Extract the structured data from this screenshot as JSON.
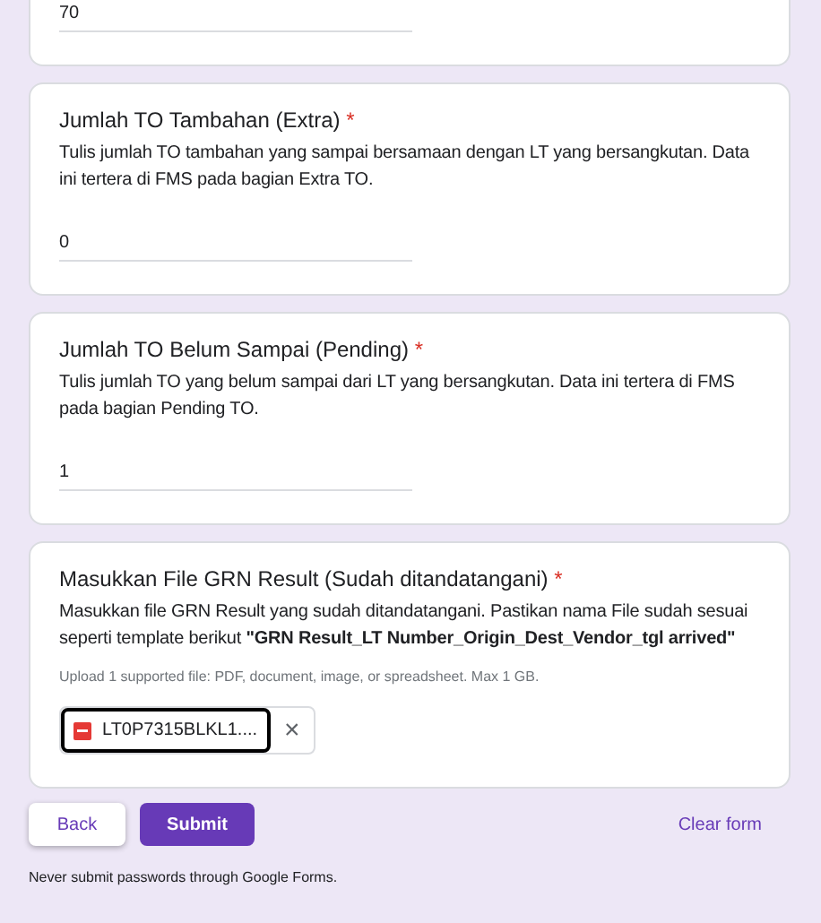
{
  "questions": [
    {
      "kind": "text",
      "answer": "70"
    },
    {
      "kind": "text",
      "title": "Jumlah TO Tambahan (Extra)",
      "required_mark": "*",
      "description": "Tulis jumlah TO tambahan yang sampai bersamaan dengan LT yang bersangkutan. Data ini  tertera di FMS pada bagian Extra TO.",
      "answer": "0"
    },
    {
      "kind": "text",
      "title": "Jumlah TO Belum Sampai (Pending)",
      "required_mark": "*",
      "description": "Tulis jumlah TO yang belum sampai dari LT yang bersangkutan. Data ini  tertera di FMS pada bagian Pending TO.",
      "answer": "1"
    },
    {
      "kind": "file",
      "title": "Masukkan File GRN Result (Sudah ditandatangani)",
      "required_mark": "*",
      "description": "Masukkan file GRN Result yang sudah ditandatangani. Pastikan nama File sudah sesuai seperti template berikut **\"GRN Result_LT Number_Origin_Dest_Vendor_tgl arrived\"**",
      "hint": "Upload 1 supported file: PDF, document, image, or spreadsheet. Max 1 GB.",
      "file": {
        "name": "LT0P7315BLKL1....",
        "focused": true,
        "remove": "×"
      }
    }
  ],
  "buttons": {
    "back": "Back",
    "submit": "Submit",
    "clear": "Clear form"
  },
  "footer": "Never submit passwords through Google Forms."
}
